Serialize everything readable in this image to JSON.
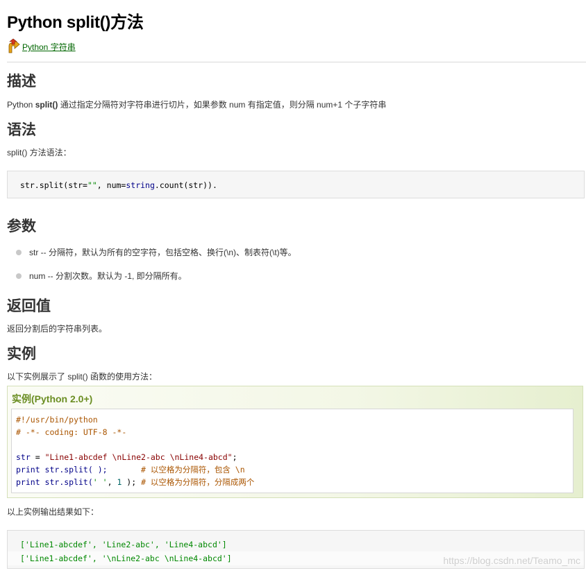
{
  "page": {
    "title": "Python split()方法",
    "back_link": "Python 字符串"
  },
  "sections": {
    "desc": {
      "heading": "描述",
      "text_prefix": "Python ",
      "text_bold": "split()",
      "text_suffix": " 通过指定分隔符对字符串进行切片，如果参数 num 有指定值，则分隔 num+1 个子字符串"
    },
    "syntax": {
      "heading": "语法",
      "intro": "split() 方法语法：",
      "code": {
        "p1": "str.split(str=",
        "s1": "\"\"",
        "p2": ", num=",
        "k1": "string",
        "p3": ".count(str))."
      }
    },
    "params": {
      "heading": "参数",
      "items": [
        "str -- 分隔符，默认为所有的空字符，包括空格、换行(\\n)、制表符(\\t)等。",
        "num -- 分割次数。默认为 -1, 即分隔所有。"
      ]
    },
    "return": {
      "heading": "返回值",
      "text": "返回分割后的字符串列表。"
    },
    "example": {
      "heading": "实例",
      "intro": "以下实例展示了 split() 函数的使用方法：",
      "box_title": "实例(Python 2.0+)",
      "code": {
        "l1": "#!/usr/bin/python",
        "l2": "# -*- coding: UTF-8 -*-",
        "l4_var": "str",
        "l4_eq": " = ",
        "l4_str": "\"Line1-abcdef \\nLine2-abc \\nLine4-abcd\"",
        "l4_end": ";",
        "l5_kw": "print",
        "l5_code": " str.split( );       ",
        "l5_comment": "# 以空格为分隔符，包含 \\n",
        "l6_kw": "print",
        "l6_code_a": " str.split(",
        "l6_str": "' '",
        "l6_code_b": ", ",
        "l6_num": "1",
        "l6_code_c": " ); ",
        "l6_comment": "# 以空格为分隔符，分隔成两个"
      },
      "output_intro": "以上实例输出结果如下：",
      "output": [
        "['Line1-abcdef', 'Line2-abc', 'Line4-abcd']",
        "['Line1-abcdef', '\\nLine2-abc \\nLine4-abcd']"
      ]
    }
  },
  "watermark": "https://blog.csdn.net/Teamo_mc",
  "colors": {
    "link": "#006600",
    "example_title": "#6b8e23",
    "comment": "#aa5500",
    "string": "#880000",
    "keyword": "#000088",
    "output": "#008800"
  },
  "icons": {
    "back": "up-arrow-icon"
  }
}
